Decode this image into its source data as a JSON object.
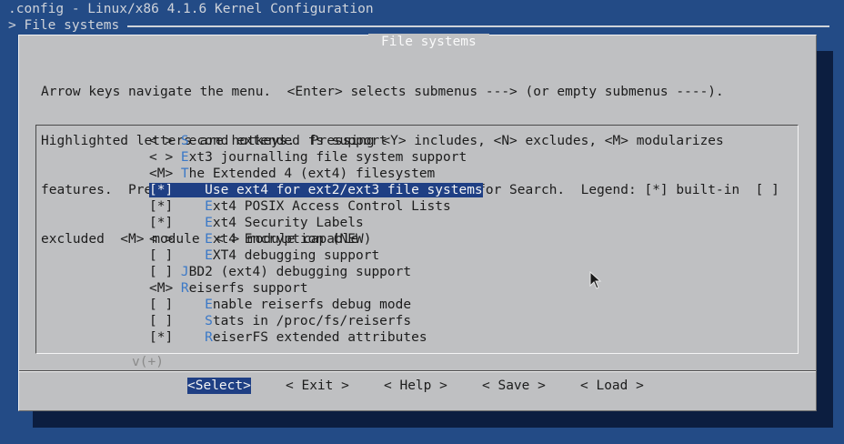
{
  "header": {
    "title": ".config - Linux/x86 4.1.6 Kernel Configuration",
    "breadcrumb": "> File systems"
  },
  "dialog": {
    "title": "File systems",
    "help_lines": [
      "Arrow keys navigate the menu.  <Enter> selects submenus ---> (or empty submenus ----).",
      "Highlighted letters are hotkeys.  Pressing <Y> includes, <N> excludes, <M> modularizes",
      "features.  Press <Esc><Esc> to exit, <?> for Help, </> for Search.  Legend: [*] built-in  [ ]",
      "excluded  <M> module  < > module capable"
    ]
  },
  "menu": {
    "items": [
      {
        "prefix": "< > ",
        "hotkey": "S",
        "rest": "econd extended fs support"
      },
      {
        "prefix": "< > ",
        "hotkey": "E",
        "rest": "xt3 journalling file system support"
      },
      {
        "prefix": "<M> ",
        "hotkey": "T",
        "rest": "he Extended 4 (ext4) filesystem"
      },
      {
        "prefix": "[*]    ",
        "hotkey": "U",
        "rest": "se ext4 for ext2/ext3 file systems"
      },
      {
        "prefix": "[*]    ",
        "hotkey": "E",
        "rest": "xt4 POSIX Access Control Lists"
      },
      {
        "prefix": "[*]    ",
        "hotkey": "E",
        "rest": "xt4 Security Labels"
      },
      {
        "prefix": "< >    ",
        "hotkey": "E",
        "rest": "xt4 Encryption (NEW)"
      },
      {
        "prefix": "[ ]    ",
        "hotkey": "E",
        "rest": "XT4 debugging support"
      },
      {
        "prefix": "[ ] ",
        "hotkey": "J",
        "rest": "BD2 (ext4) debugging support"
      },
      {
        "prefix": "<M> ",
        "hotkey": "R",
        "rest": "eiserfs support"
      },
      {
        "prefix": "[ ]    ",
        "hotkey": "E",
        "rest": "nable reiserfs debug mode"
      },
      {
        "prefix": "[ ]    ",
        "hotkey": "S",
        "rest": "tats in /proc/fs/reiserfs"
      },
      {
        "prefix": "[*]    ",
        "hotkey": "R",
        "rest": "eiserFS extended attributes"
      }
    ],
    "selected_index": 3,
    "more_indicator": "v(+)"
  },
  "buttons": {
    "select": "<Select>",
    "exit": "< Exit >",
    "help": "< Help >",
    "save": "< Save >",
    "load": "< Load >"
  },
  "colors": {
    "background": "#234b86",
    "dialog": "#bfc0c2",
    "highlight": "#1f3f84",
    "hotkey": "#3a78c7"
  }
}
